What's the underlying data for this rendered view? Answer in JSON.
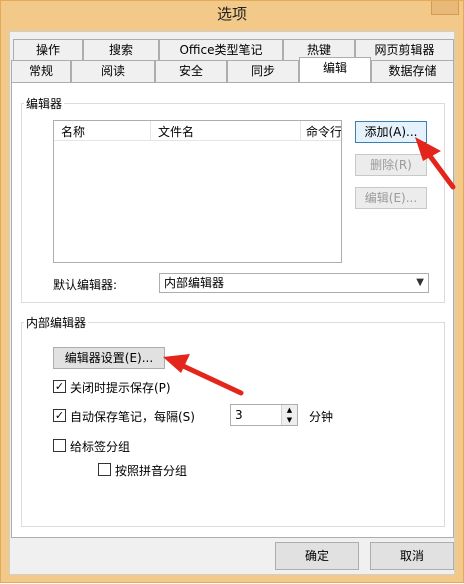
{
  "window": {
    "title": "选项"
  },
  "tabs_row1": [
    {
      "label": "操作"
    },
    {
      "label": "搜索"
    },
    {
      "label": "Office类型笔记"
    },
    {
      "label": "热键"
    },
    {
      "label": "网页剪辑器"
    }
  ],
  "tabs_row2": [
    {
      "label": "常规"
    },
    {
      "label": "阅读"
    },
    {
      "label": "安全"
    },
    {
      "label": "同步"
    },
    {
      "label": "编辑"
    },
    {
      "label": "数据存储"
    }
  ],
  "editors": {
    "group_label": "编辑器",
    "columns": [
      "名称",
      "文件名",
      "命令行"
    ],
    "add_button": "添加(A)...",
    "delete_button": "删除(R)",
    "edit_button": "编辑(E)...",
    "default_label": "默认编辑器:",
    "default_value": "内部编辑器"
  },
  "internal": {
    "group_label": "内部编辑器",
    "settings_button": "编辑器设置(E)...",
    "prompt_save_label": "关闭时提示保存(P)",
    "prompt_save_checked": true,
    "autosave_label": "自动保存笔记，每隔(S)",
    "autosave_checked": true,
    "autosave_minutes": "3",
    "minutes_unit": "分钟",
    "group_by_tag_label": "给标签分组",
    "group_by_tag_checked": false,
    "group_by_pinyin_label": "按照拼音分组",
    "group_by_pinyin_checked": false
  },
  "footer": {
    "ok": "确定",
    "cancel": "取消"
  }
}
